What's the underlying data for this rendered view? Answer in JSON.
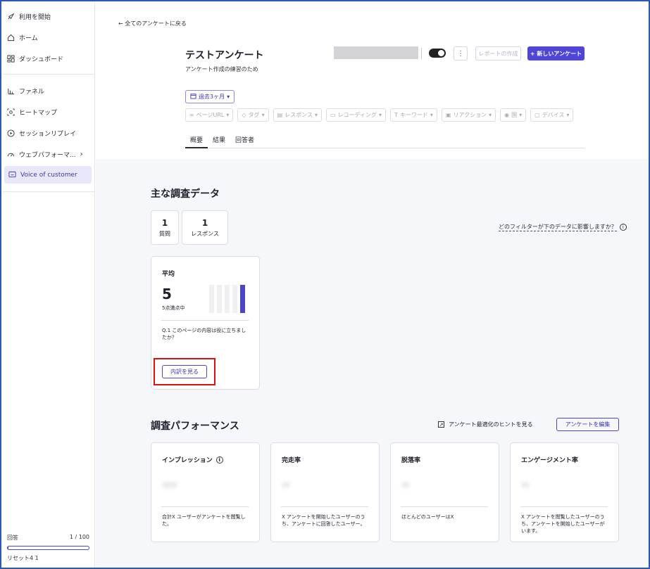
{
  "sidebar": {
    "items": [
      {
        "label": "利用を開始",
        "icon": "rocket-icon"
      },
      {
        "label": "ホーム",
        "icon": "home-icon"
      },
      {
        "label": "ダッシュボード",
        "icon": "dashboard-icon"
      },
      {
        "label": "ファネル",
        "icon": "funnel-icon"
      },
      {
        "label": "ヒートマップ",
        "icon": "heatmap-icon"
      },
      {
        "label": "セッションリプレイ",
        "icon": "replay-icon"
      },
      {
        "label": "ウェブパフォーマ...",
        "icon": "gauge-icon"
      },
      {
        "label": "Voice of customer",
        "icon": "feedback-icon"
      }
    ],
    "quota": {
      "label": "回答",
      "value": "1 / 100",
      "progress": 0.01,
      "reset": "リセット4 1"
    }
  },
  "header": {
    "back": "全てのアンケートに戻る",
    "title": "テストアンケート",
    "subtitle": "アンケート作成の練習のため",
    "report_button": "レポートの作成",
    "new_button": "+ 新しいアンケート",
    "more": "⋮"
  },
  "filters": {
    "period": "過去3ヶ月",
    "items": [
      "ページURL",
      "タグ",
      "レスポンス",
      "レコーディング",
      "キーワード",
      "リアクション",
      "国",
      "デバイス"
    ]
  },
  "tabs": [
    "概要",
    "結果",
    "回答者"
  ],
  "overview": {
    "title": "主な調査データ",
    "stats": [
      {
        "value": "1",
        "label": "質問"
      },
      {
        "value": "1",
        "label": "レスポンス"
      }
    ],
    "filter_question": "どのフィルターが下のデータに影響しますか？",
    "average": {
      "title": "平均",
      "value": "5",
      "caption": "5点満点中",
      "question": "Q.1 このページの内容は役に立ちましたか？",
      "button": "内訳を見る",
      "bars": [
        0,
        0,
        0,
        0,
        1
      ]
    }
  },
  "performance": {
    "title": "調査パフォーマンス",
    "hint": "アンケート最適化のヒントを見る",
    "edit_button": "アンケートを編集",
    "cards": [
      {
        "title": "インプレッション",
        "desc": "合計X ユーザーがアンケートを閲覧した。"
      },
      {
        "title": "完走率",
        "desc": "X アンケートを開始したユーザーのうち、アンケートに回答したユーザー。"
      },
      {
        "title": "脱落率",
        "desc": "ほとんどのユーザーはX"
      },
      {
        "title": "エンゲージメント率",
        "desc": "X アンケートを閲覧したユーザーのうち、アンケートを開始したユーザーがいます。"
      }
    ]
  }
}
